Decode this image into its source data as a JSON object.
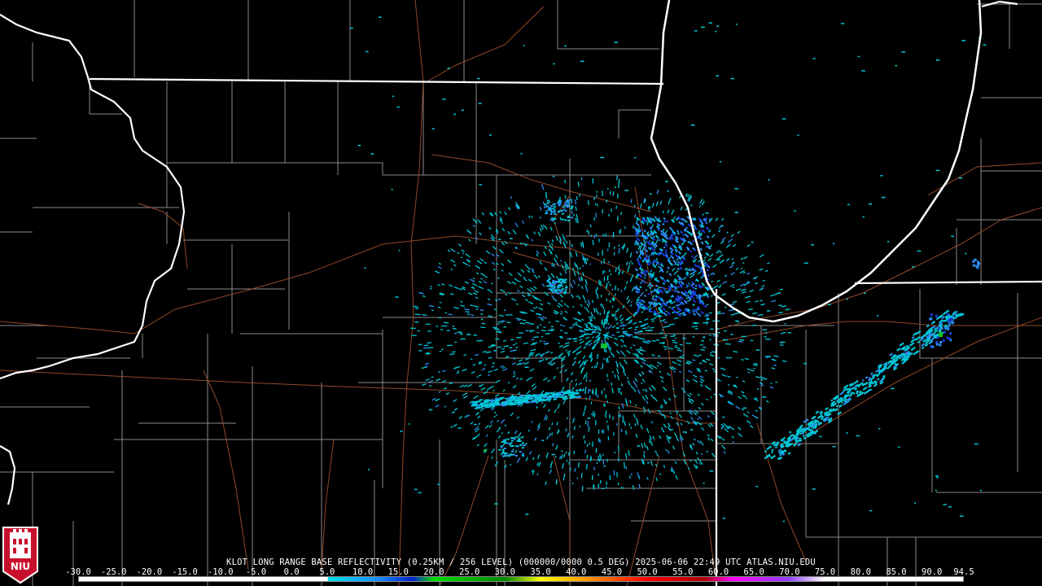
{
  "title": "KLOT LONG RANGE BASE REFLECTIVITY (0.25KM / 256 LEVEL) (000000/0000 0.5 DEG) 2025-06-06 22:49 UTC  ATLAS.NIU.EDU",
  "logo_text": "NIU",
  "scale_labels": [
    "-30.0",
    "-25.0",
    "-20.0",
    "-15.0",
    "-10.0",
    "-5.0",
    "0.0",
    "5.0",
    "10.0",
    "15.0",
    "20.0",
    "25.0",
    "30.0",
    "35.0",
    "40.0",
    "45.0",
    "50.0",
    "55.0",
    "60.0",
    "65.0",
    "70.0",
    "75.0",
    "80.0",
    "85.0",
    "90.0",
    "94.5"
  ],
  "scale_values": [
    -30,
    -25,
    -20,
    -15,
    -10,
    -5,
    0,
    5,
    10,
    15,
    20,
    25,
    30,
    35,
    40,
    45,
    50,
    55,
    60,
    65,
    70,
    75,
    80,
    85,
    90,
    94.5
  ],
  "colors": {
    "background": "#000000",
    "state_borders": "#ffffff",
    "county_lines": "#8a8a8a",
    "roads": "#a0522d",
    "echo_light": "#00c8d8",
    "echo_mid": "#2a8cf0",
    "echo_heavy": "#1840e0",
    "echo_green": "#10c030"
  },
  "colorbar_stops": [
    {
      "value": -30,
      "color": "#ffffff"
    },
    {
      "value": 5,
      "color": "#ffffff"
    },
    {
      "value": 5.1,
      "color": "#00e0e8"
    },
    {
      "value": 12,
      "color": "#1890ff"
    },
    {
      "value": 17,
      "color": "#0020d0"
    },
    {
      "value": 20,
      "color": "#00e000"
    },
    {
      "value": 30,
      "color": "#008800"
    },
    {
      "value": 35,
      "color": "#ffff00"
    },
    {
      "value": 42,
      "color": "#ff9000"
    },
    {
      "value": 50,
      "color": "#ff0000"
    },
    {
      "value": 58,
      "color": "#b00000"
    },
    {
      "value": 62,
      "color": "#ff00ff"
    },
    {
      "value": 70,
      "color": "#9040ff"
    },
    {
      "value": 75,
      "color": "#ffffff"
    },
    {
      "value": 94.5,
      "color": "#ffffff"
    }
  ]
}
